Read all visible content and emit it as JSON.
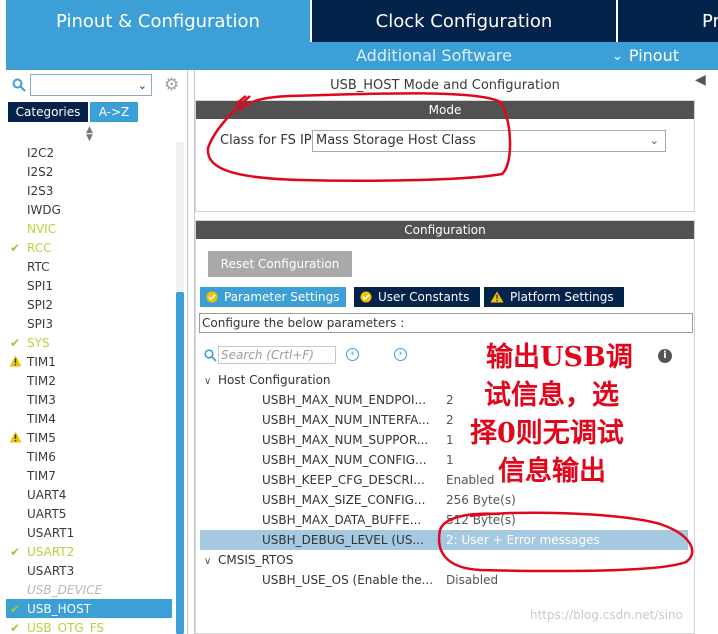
{
  "tabs": {
    "pinout_config": "Pinout & Configuration",
    "clock_config": "Clock Configuration",
    "project_partial": "Pr"
  },
  "subbar": {
    "additional_software": "Additional Software",
    "pinout": "Pinout"
  },
  "left": {
    "category_tabs": [
      "Categories",
      "A->Z"
    ],
    "peripherals": [
      {
        "name": "I2C2",
        "state": "normal"
      },
      {
        "name": "I2S2",
        "state": "normal"
      },
      {
        "name": "I2S3",
        "state": "normal"
      },
      {
        "name": "IWDG",
        "state": "normal"
      },
      {
        "name": "NVIC",
        "state": "green"
      },
      {
        "name": "RCC",
        "state": "green-check"
      },
      {
        "name": "RTC",
        "state": "normal"
      },
      {
        "name": "SPI1",
        "state": "normal"
      },
      {
        "name": "SPI2",
        "state": "normal"
      },
      {
        "name": "SPI3",
        "state": "normal"
      },
      {
        "name": "SYS",
        "state": "green-check"
      },
      {
        "name": "TIM1",
        "state": "warning"
      },
      {
        "name": "TIM2",
        "state": "normal"
      },
      {
        "name": "TIM3",
        "state": "normal"
      },
      {
        "name": "TIM4",
        "state": "normal"
      },
      {
        "name": "TIM5",
        "state": "warning"
      },
      {
        "name": "TIM6",
        "state": "normal"
      },
      {
        "name": "TIM7",
        "state": "normal"
      },
      {
        "name": "UART4",
        "state": "normal"
      },
      {
        "name": "UART5",
        "state": "normal"
      },
      {
        "name": "USART1",
        "state": "normal"
      },
      {
        "name": "USART2",
        "state": "green-check"
      },
      {
        "name": "USART3",
        "state": "normal"
      },
      {
        "name": "USB_DEVICE",
        "state": "disabled"
      },
      {
        "name": "USB_HOST",
        "state": "selected-check"
      },
      {
        "name": "USB_OTG_FS",
        "state": "green-check"
      }
    ]
  },
  "right": {
    "title": "USB_HOST Mode and Configuration",
    "mode_header": "Mode",
    "class_label": "Class for FS IP",
    "class_value": "Mass Storage Host Class",
    "config_header": "Configuration",
    "reset_button": "Reset Configuration",
    "param_tabs": [
      "Parameter Settings",
      "User Constants",
      "Platform Settings"
    ],
    "hint": "Configure the below parameters :",
    "search_placeholder": "Search (Crtl+F)",
    "groups": [
      {
        "name": "Host Configuration",
        "params": [
          {
            "name": "USBH_MAX_NUM_ENDPOI...",
            "value": "2"
          },
          {
            "name": "USBH_MAX_NUM_INTERFA...",
            "value": "2"
          },
          {
            "name": "USBH_MAX_NUM_SUPPOR...",
            "value": "1"
          },
          {
            "name": "USBH_MAX_NUM_CONFIG...",
            "value": "1"
          },
          {
            "name": "USBH_KEEP_CFG_DESCRI...",
            "value": "Enabled"
          },
          {
            "name": "USBH_MAX_SIZE_CONFIG...",
            "value": "256 Byte(s)"
          },
          {
            "name": "USBH_MAX_DATA_BUFFE...",
            "value": "512 Byte(s)"
          },
          {
            "name": "USBH_DEBUG_LEVEL (US...",
            "value": "2: User + Error messages"
          }
        ]
      },
      {
        "name": "CMSIS_RTOS",
        "params": [
          {
            "name": "USBH_USE_OS (Enable the...",
            "value": "Disabled"
          }
        ]
      }
    ]
  },
  "annotation": {
    "lines": [
      "输出USB调",
      "试信息，选",
      "择0则无调试",
      "信息输出"
    ],
    "color": "#e0061c"
  },
  "watermark": "https://blog.csdn.net/sino",
  "colors": {
    "accent": "#3c9fd6",
    "dark": "#03234b",
    "section_header": "#525252",
    "green": "#b9d23a",
    "warning": "#f2c200"
  }
}
